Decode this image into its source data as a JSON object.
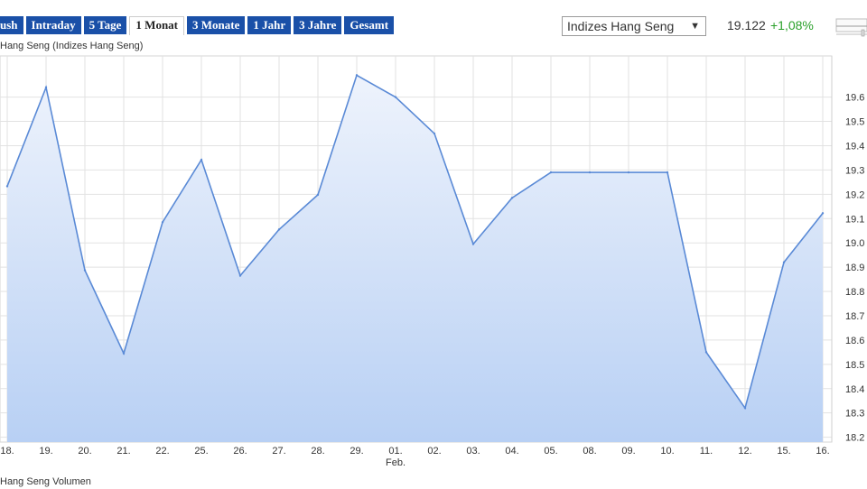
{
  "toolbar": {
    "tabs": [
      {
        "label": "ush",
        "active": false
      },
      {
        "label": "Intraday",
        "active": false
      },
      {
        "label": "5 Tage",
        "active": false
      },
      {
        "label": "1 Monat",
        "active": true
      },
      {
        "label": "3 Monate",
        "active": false
      },
      {
        "label": "1 Jahr",
        "active": false
      },
      {
        "label": "3 Jahre",
        "active": false
      },
      {
        "label": "Gesamt",
        "active": false
      }
    ],
    "index_select": "Indizes Hang Seng",
    "price": "19.122",
    "change": "+1,08%"
  },
  "colors": {
    "tab_bg": "#1a50a8",
    "line": "#5a8ad6",
    "fill_top": "#eef3fc",
    "fill_bottom": "#b8d0f4",
    "positive": "#2aa02a"
  },
  "series_label": "Hang Seng (Indizes Hang Seng)",
  "volume_label": "Hang Seng Volumen",
  "chart_data": {
    "type": "area",
    "title": "",
    "x": [
      "18.",
      "19.",
      "20.",
      "21.",
      "22.",
      "25.",
      "26.",
      "27.",
      "28.",
      "29.",
      "01.",
      "02.",
      "03.",
      "04.",
      "05.",
      "08.",
      "09.",
      "10.",
      "11.",
      "12.",
      "15.",
      "16."
    ],
    "x_sublabel": {
      "index": 10,
      "text": "Feb."
    },
    "series": [
      {
        "values": [
          19.233,
          19.64,
          18.887,
          18.545,
          19.085,
          19.342,
          18.865,
          19.055,
          19.198,
          19.69,
          19.6,
          19.45,
          18.995,
          19.185,
          19.29,
          19.29,
          19.29,
          19.29,
          18.55,
          18.32,
          18.92,
          19.122
        ]
      }
    ],
    "yticks": [
      "18.2",
      "18.3",
      "18.4",
      "18.5",
      "18.6",
      "18.7",
      "18.8",
      "18.9",
      "19.0",
      "19.1",
      "19.2",
      "19.3",
      "19.4",
      "19.5",
      "19.6"
    ],
    "ylim": [
      18.2,
      19.7
    ],
    "grid": true,
    "y_axis_side": "right"
  }
}
